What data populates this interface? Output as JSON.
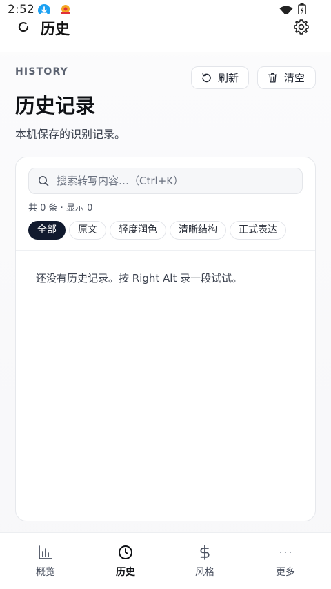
{
  "status_bar": {
    "time": "2:52",
    "icons": [
      "download-icon",
      "app-notification-icon",
      "wifi-icon",
      "battery-icon"
    ]
  },
  "app_bar": {
    "title": "历史",
    "icons": [
      "spinner-icon",
      "gear-icon"
    ]
  },
  "header": {
    "eyebrow": "HISTORY",
    "title": "历史记录",
    "subtitle": "本机保存的识别记录。",
    "refresh_label": "刷新",
    "clear_label": "清空"
  },
  "card": {
    "search": {
      "value": "",
      "placeholder": "搜索转写内容…（Ctrl+K）"
    },
    "count_text": "共 0 条 · 显示 0",
    "filters": [
      {
        "label": "全部",
        "active": true
      },
      {
        "label": "原文",
        "active": false
      },
      {
        "label": "轻度润色",
        "active": false
      },
      {
        "label": "清晰结构",
        "active": false
      },
      {
        "label": "正式表达",
        "active": false
      }
    ],
    "empty_text": "还没有历史记录。按 Right Alt 录一段试试。"
  },
  "bottom_nav": {
    "items": [
      {
        "label": "概览",
        "icon": "bar-chart-icon",
        "active": false
      },
      {
        "label": "历史",
        "icon": "clock-icon",
        "active": true
      },
      {
        "label": "风格",
        "icon": "dollar-icon",
        "active": false
      },
      {
        "label": "更多",
        "icon": "more-dots-icon",
        "active": false
      }
    ]
  },
  "colors": {
    "accent": "#111a2e",
    "border": "#e6e8ec",
    "text": "#111827",
    "muted": "#5b6270"
  }
}
